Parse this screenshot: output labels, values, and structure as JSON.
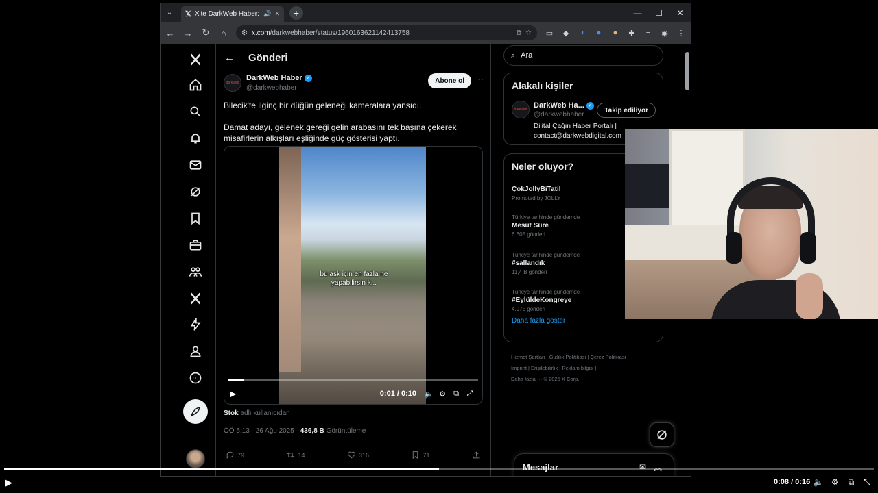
{
  "browser": {
    "tab_title": "X'te DarkWeb Haber: \"Bilecik",
    "url_host": "x.com",
    "url_path": "/darkwebhaber/status/1960163621142413758"
  },
  "x": {
    "header_title": "Gönderi",
    "author_name": "DarkWeb Haber",
    "author_handle": "@darkwebhaber",
    "avatar_label": "darkweb",
    "subscribe_label": "Abone ol",
    "post_line1": "Bilecik'te ilginç bir düğün geleneği kameralara yansıdı.",
    "post_line2": "Damat adayı, gelenek gereği gelin arabasını tek başına çekerek misafirlerin alkışları eşliğinde güç gösterisi yaptı.",
    "video_caption": "bu aşk için en fazla ne yapabilirsin k...",
    "video_time": "0:01 / 0:10",
    "video_progress": 0.06,
    "credit_user": "Stok",
    "credit_suffix": "adlı kullanıcıdan",
    "meta_time": "ÖÖ 5:13 · 26 Ağu 2025 · ",
    "meta_views": "436,8 B",
    "meta_views_label": "Görüntüleme",
    "replies": "79",
    "reposts": "14",
    "likes": "316",
    "bookmarks": "71"
  },
  "sidebar": {
    "search_placeholder": "Ara",
    "related_title": "Alakalı kişiler",
    "rp_name": "DarkWeb Ha...",
    "rp_handle": "@darkwebhaber",
    "rp_follow": "Takip ediliyor",
    "rp_bio1": "Dijital Çağın Haber Portalı |",
    "rp_bio2": "contact@darkwebdigital.com",
    "trends_title": "Neler oluyor?",
    "trends": [
      {
        "context": "",
        "name": "ÇokJollyBiTatil",
        "count": "Promoted by JOLLY"
      },
      {
        "context": "Türkiye tarihinde gündemde",
        "name": "Mesut Süre",
        "count": "6.605 gönderi"
      },
      {
        "context": "Türkiye tarihinde gündemde",
        "name": "#sallandık",
        "count": "11,4 B gönderi"
      },
      {
        "context": "Türkiye tarihinde gündemde",
        "name": "#EylüldeKongreye",
        "count": "4.975 gönderi"
      }
    ],
    "show_more": "Daha fazla göster",
    "footer_line1": "Hizmet Şartları  |  Gizlilik Politikası  |  Çerez Politikası  |",
    "footer_line2": "Imprint  |  Erişilebilirlik  |  Reklam bilgisi  |",
    "footer_line3": "Daha fazla ···   © 2025 X Corp.",
    "messages_label": "Mesajlar"
  },
  "player": {
    "time": "0:08 / 0:16",
    "progress": 0.5
  }
}
